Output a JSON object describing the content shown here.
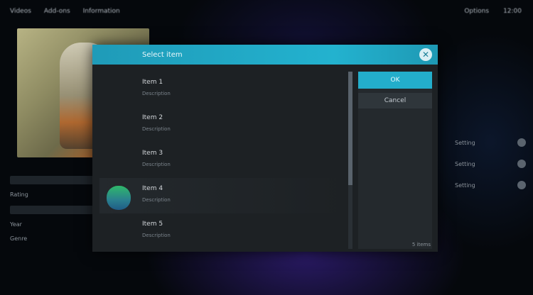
{
  "topbar": {
    "crumbs": [
      "Videos",
      "Add-ons",
      "Information"
    ],
    "right": [
      "Options",
      "12:00"
    ]
  },
  "left_panel": {
    "info_lines": [
      "Rating",
      "Year",
      "Genre"
    ]
  },
  "right_panel": {
    "options": [
      "Setting",
      "Setting",
      "Setting"
    ]
  },
  "dialog": {
    "title": "Select item",
    "items": [
      {
        "label": "Item 1",
        "sub": "Description"
      },
      {
        "label": "Item 2",
        "sub": "Description"
      },
      {
        "label": "Item 3",
        "sub": "Description"
      },
      {
        "label": "Item 4",
        "sub": "Description"
      },
      {
        "label": "Item 5",
        "sub": "Description"
      }
    ],
    "buttons": {
      "primary": "OK",
      "secondary": "Cancel"
    },
    "count": "5 items"
  },
  "colors": {
    "accent": "#23b2cf",
    "dialog_bg": "#1d2124",
    "background": "#05080c"
  }
}
